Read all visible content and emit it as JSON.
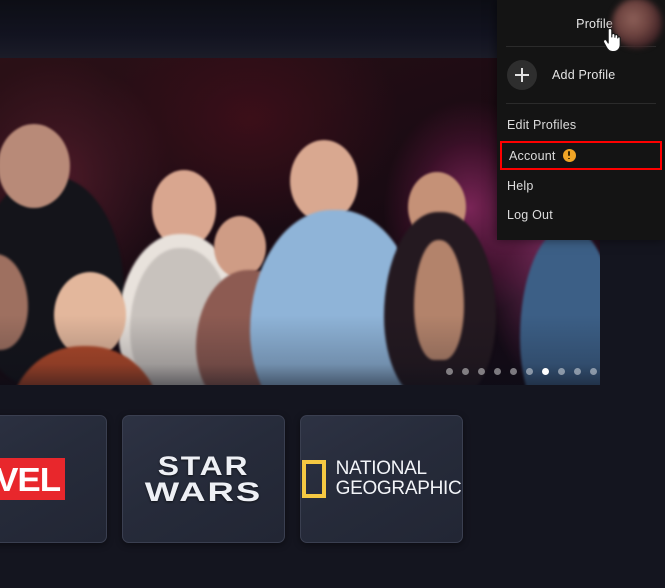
{
  "app": {
    "background_color": "#14151f",
    "panel_background": "#141414",
    "highlight_color": "#ff0000",
    "warning_color": "#f0a526"
  },
  "profile_menu": {
    "header_label": "Profile",
    "avatar_icon": "user-avatar",
    "add_profile": {
      "icon": "plus-icon",
      "label": "Add Profile"
    },
    "items": [
      {
        "label": "Edit Profiles",
        "icon": null,
        "highlighted": false
      },
      {
        "label": "Account",
        "icon": "warning-icon",
        "highlighted": true
      },
      {
        "label": "Help",
        "icon": null,
        "highlighted": false
      },
      {
        "label": "Log Out",
        "icon": null,
        "highlighted": false
      }
    ]
  },
  "hero": {
    "alt": "Group of people laughing on stage",
    "carousel": {
      "total_dots": 10,
      "active_index": 6
    }
  },
  "brand_tiles": [
    {
      "name": "marvel",
      "logo_text": "VEL",
      "partial": true
    },
    {
      "name": "star-wars",
      "line1": "STAR",
      "line2": "WARS",
      "partial": false
    },
    {
      "name": "national-geographic",
      "line1": "NATIONAL",
      "line2": "GEOGRAPHIC",
      "partial": false
    }
  ],
  "cursor": {
    "type": "pointing-hand"
  }
}
